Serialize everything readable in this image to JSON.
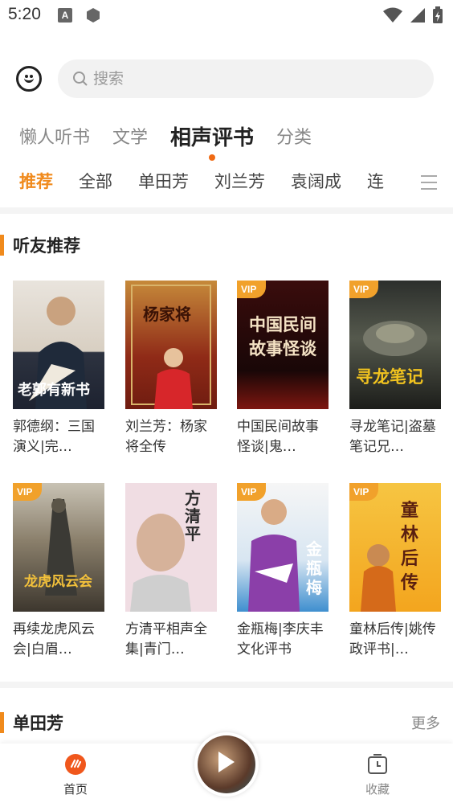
{
  "status_bar": {
    "time": "5:20",
    "a_icon": "A"
  },
  "search": {
    "placeholder": "搜索"
  },
  "category_tabs": [
    {
      "label": "懒人听书"
    },
    {
      "label": "文学"
    },
    {
      "label": "相声评书",
      "active": true
    },
    {
      "label": "分类"
    }
  ],
  "sub_tabs": [
    {
      "label": "推荐",
      "active": true
    },
    {
      "label": "全部"
    },
    {
      "label": "单田芳"
    },
    {
      "label": "刘兰芳"
    },
    {
      "label": "袁阔成"
    },
    {
      "label": "连"
    }
  ],
  "section1": {
    "title": "听友推荐",
    "books": [
      {
        "title": "郭德纲：三国演义|完…",
        "vip": false,
        "cover_text": "老郭有新书",
        "vip_label": ""
      },
      {
        "title": "刘兰芳：杨家将全传",
        "vip": false,
        "cover_text": "杨家将",
        "vip_label": ""
      },
      {
        "title": "中国民间故事怪谈|鬼…",
        "vip": true,
        "cover_text": "中国民间故事怪谈",
        "vip_label": "VIP"
      },
      {
        "title": "寻龙笔记|盗墓笔记兄…",
        "vip": true,
        "cover_text": "寻龙笔记",
        "vip_label": "VIP"
      },
      {
        "title": "再续龙虎风云会|白眉…",
        "vip": true,
        "cover_text": "龙虎风云会",
        "vip_label": "VIP"
      },
      {
        "title": "方清平相声全集|青门…",
        "vip": false,
        "cover_text": "方清平",
        "vip_label": ""
      },
      {
        "title": "金瓶梅|李庆丰文化评书",
        "vip": true,
        "cover_text": "金瓶梅",
        "vip_label": "VIP"
      },
      {
        "title": "童林后传|姚传政评书|…",
        "vip": true,
        "cover_text": "童林后传",
        "vip_label": "VIP"
      }
    ]
  },
  "section2": {
    "title": "单田芳",
    "more": "更多"
  },
  "bottom_nav": {
    "home": "首页",
    "favorites": "收藏"
  },
  "colors": {
    "accent": "#f08a1c",
    "vip": "#f1a12b",
    "home_icon": "#f0571c"
  }
}
